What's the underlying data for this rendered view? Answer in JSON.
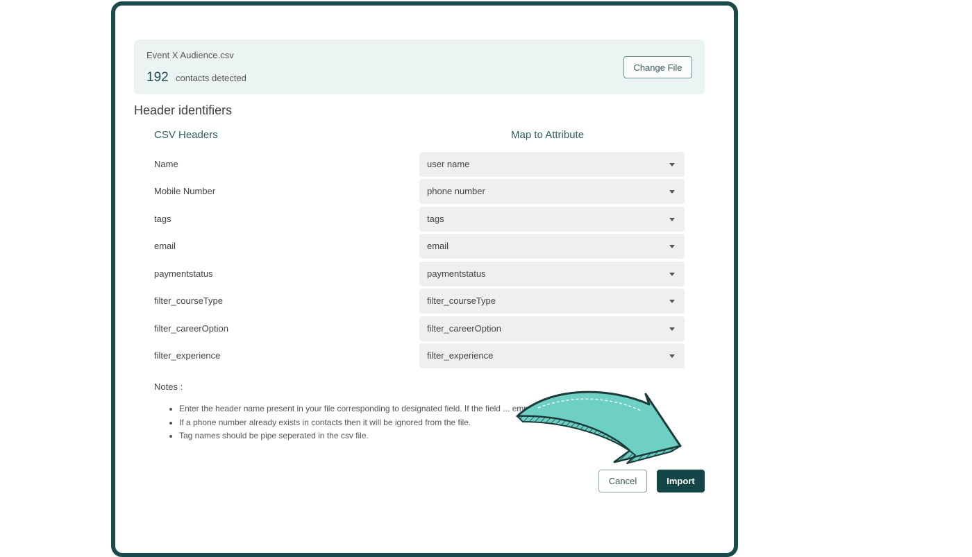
{
  "file": {
    "name": "Event X Audience.csv",
    "count": "192",
    "count_label": "contacts detected",
    "change_label": "Change File"
  },
  "section_title": "Header identifiers",
  "columns": {
    "csv_headers": "CSV Headers",
    "map_to_attribute": "Map to Attribute"
  },
  "mappings": [
    {
      "header": "Name",
      "attribute": "user name"
    },
    {
      "header": "Mobile Number",
      "attribute": "phone number"
    },
    {
      "header": "tags",
      "attribute": "tags"
    },
    {
      "header": "email",
      "attribute": "email"
    },
    {
      "header": "paymentstatus",
      "attribute": "paymentstatus"
    },
    {
      "header": "filter_courseType",
      "attribute": "filter_courseType"
    },
    {
      "header": "filter_careerOption",
      "attribute": "filter_careerOption"
    },
    {
      "header": "filter_experience",
      "attribute": "filter_experience"
    }
  ],
  "notes": {
    "title": "Notes :",
    "items": [
      "Enter the header name present in your file corresponding to designated field. If the field ... empty.",
      "If a phone number already exists in contacts then it will be ignored from the file.",
      "Tag names should be pipe seperated in the csv file."
    ]
  },
  "actions": {
    "cancel_label": "Cancel",
    "import_label": "Import"
  },
  "icons": {
    "dropdown": "chevron-down-icon",
    "callout": "curved-arrow-icon"
  },
  "colors": {
    "frame": "#1b4a4c",
    "card_bg": "#ebf4f2",
    "primary": "#134446",
    "arrow_fill": "#6ecfc4"
  }
}
